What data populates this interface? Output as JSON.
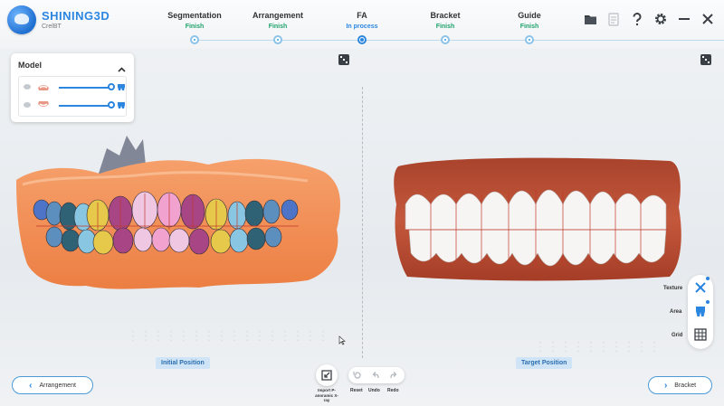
{
  "app": {
    "brand": "SHINING3D",
    "product": "CrelBT"
  },
  "steps": [
    {
      "name": "Segmentation",
      "state": "Finish"
    },
    {
      "name": "Arrangement",
      "state": "Finish"
    },
    {
      "name": "FA",
      "state": "In process"
    },
    {
      "name": "Bracket",
      "state": "Finish"
    },
    {
      "name": "Guide",
      "state": "Finish"
    }
  ],
  "toolbar_icons": [
    "folder-icon",
    "document-icon",
    "help-icon",
    "settings-icon",
    "minimize-icon",
    "close-icon"
  ],
  "model_panel": {
    "title": "Model"
  },
  "viewports": {
    "left_label": "Initial Position",
    "right_label": "Target Position"
  },
  "side_tools": {
    "texture": "Texture",
    "area": "Area",
    "grid": "Grid"
  },
  "bottom": {
    "import_label": "Import P-anoramic X-ray",
    "reset": "Reset",
    "undo": "Undo",
    "redo": "Redo",
    "prev": "Arrangement",
    "next": "Bracket"
  },
  "colors": {
    "accent": "#2b86e0",
    "finish": "#1ea26b",
    "gum_scan": "#f08a4b",
    "gum_target": "#b8472c"
  }
}
